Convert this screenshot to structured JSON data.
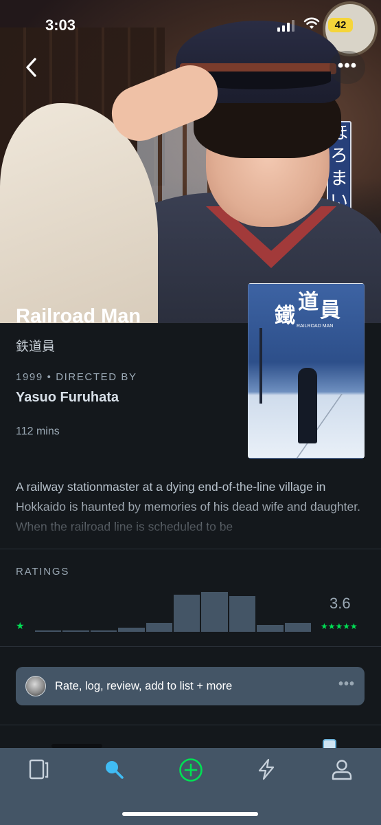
{
  "status_bar": {
    "time": "3:03",
    "battery": "42"
  },
  "nav": {
    "back_icon": "chevron-left-icon",
    "more_label": "•••"
  },
  "backdrop": {
    "sign_text": "ほろまい"
  },
  "film": {
    "title": "Railroad Man",
    "original_title": "鉄道員",
    "year": "1999",
    "directed_by_label": "DIRECTED BY",
    "director": "Yasuo Furuhata",
    "runtime": "112 mins",
    "synopsis": "A railway stationmaster at a dying end-of-the-line village in Hokkaido is haunted by memories of his dead wife and daughter. When the railroad line is scheduled to be"
  },
  "poster": {
    "kanji_1": "鐵",
    "kanji_2": "道",
    "kanji_3": "員",
    "subtitle": "RAILROAD MAN"
  },
  "ratings": {
    "heading": "RATINGS",
    "average": "3.6",
    "min_star": "★",
    "max_stars": "★★★★★",
    "histogram": [
      0.03,
      0.03,
      0.03,
      0.11,
      0.23,
      0.93,
      1.0,
      0.9,
      0.17,
      0.23
    ]
  },
  "actions": {
    "rate_label": "Rate, log, review, add to list + more",
    "more_label": "•••"
  },
  "tabbar": {
    "tabs": [
      {
        "name": "films-icon",
        "active": false
      },
      {
        "name": "search-icon",
        "active": true
      },
      {
        "name": "add-icon",
        "active": false
      },
      {
        "name": "activity-icon",
        "active": false
      },
      {
        "name": "profile-icon",
        "active": false
      }
    ]
  },
  "colors": {
    "background": "#14181c",
    "panel": "#445566",
    "accent_green": "#00e054",
    "accent_blue": "#40bcf4",
    "muted_text": "#9aa8b4"
  }
}
